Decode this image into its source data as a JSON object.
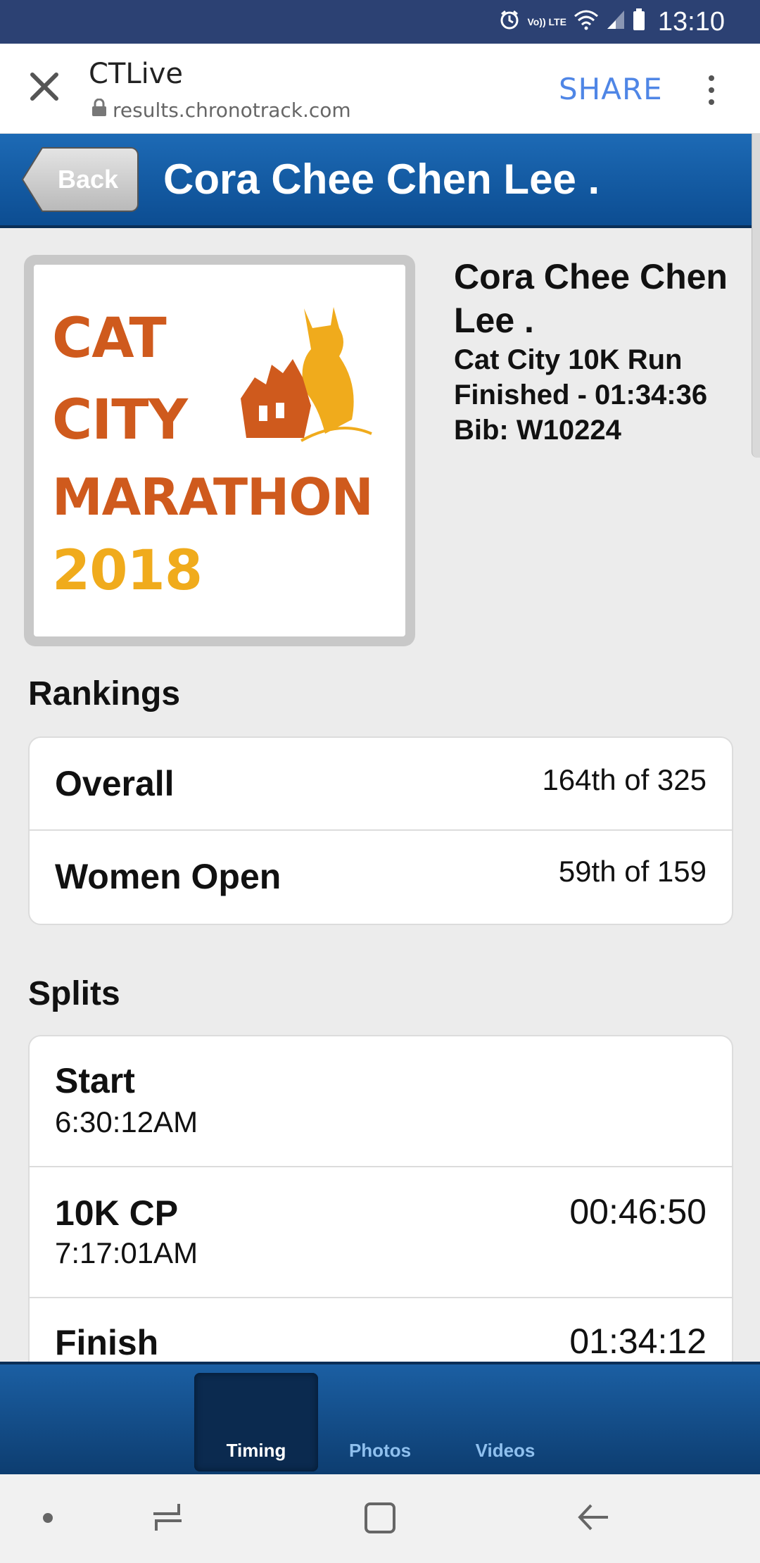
{
  "status_bar": {
    "time": "13:10",
    "network_label": "Vo)) LTE"
  },
  "browser": {
    "title": "CTLive",
    "url": "results.chronotrack.com",
    "share_label": "SHARE"
  },
  "header": {
    "back_label": "Back",
    "title": "Cora Chee Chen Lee ."
  },
  "profile": {
    "logo_lines": [
      "CAT",
      "CITY",
      "MARATHON",
      "2018"
    ],
    "name": "Cora Chee Chen Lee .",
    "event": "Cat City 10K Run",
    "finished": "Finished - 01:34:36",
    "bib": "Bib: W10224"
  },
  "rankings": {
    "title": "Rankings",
    "rows": [
      {
        "label": "Overall",
        "value": "164th of 325"
      },
      {
        "label": "Women Open",
        "value": "59th of 159"
      }
    ]
  },
  "splits": {
    "title": "Splits",
    "rows": [
      {
        "label": "Start",
        "time_of_day": "6:30:12AM",
        "elapsed": ""
      },
      {
        "label": "10K CP",
        "time_of_day": "7:17:01AM",
        "elapsed": "00:46:50"
      },
      {
        "label": "Finish",
        "time_of_day": "",
        "elapsed": "01:34:12"
      }
    ]
  },
  "tabs": [
    {
      "label": "Timing",
      "active": true
    },
    {
      "label": "Photos",
      "active": false
    },
    {
      "label": "Videos",
      "active": false
    }
  ],
  "colors": {
    "status_bar": "#2c4173",
    "header_blue": "#1d6ab5",
    "share_blue": "#4f86e6",
    "logo_orange": "#cf5a1d",
    "logo_yellow": "#f0ab1c"
  }
}
